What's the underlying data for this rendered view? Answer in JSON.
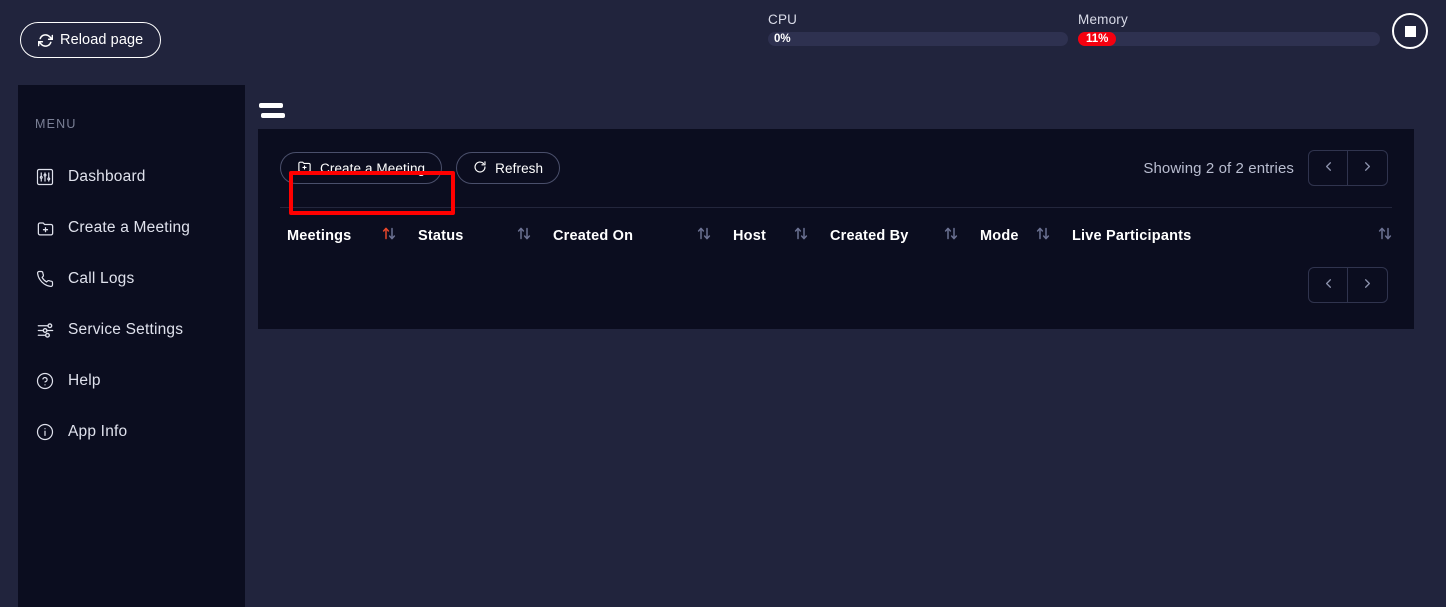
{
  "topbar": {
    "reload_label": "Reload page",
    "reload_icon": "refresh-icon",
    "cpu": {
      "label": "CPU",
      "value": "0%"
    },
    "memory": {
      "label": "Memory",
      "value": "11%"
    },
    "stop_icon": "stop-square-icon",
    "badge_color": "#f5000f"
  },
  "sidebar": {
    "title": "MENU",
    "items": [
      {
        "label": "Dashboard",
        "icon": "dashboard-sliders-icon"
      },
      {
        "label": "Create a Meeting",
        "icon": "folder-plus-icon"
      },
      {
        "label": "Call Logs",
        "icon": "phone-icon"
      },
      {
        "label": "Service Settings",
        "icon": "settings-sliders-icon"
      },
      {
        "label": "Help",
        "icon": "question-circle-icon"
      },
      {
        "label": "App Info",
        "icon": "info-circle-icon"
      }
    ]
  },
  "main": {
    "toggle_icon": "menu-toggle-icon",
    "toolbar": {
      "create_label": "Create a Meeting",
      "create_icon": "folder-plus-icon",
      "refresh_label": "Refresh",
      "refresh_icon": "refresh-circle-icon",
      "entries_text": "Showing 2 of 2 entries",
      "prev_icon": "chevron-left-icon",
      "next_icon": "chevron-right-icon",
      "highlight_color": "#ff0000"
    },
    "table": {
      "columns": [
        {
          "label": "Meetings",
          "sort": "active"
        },
        {
          "label": "Status",
          "sort": "inactive"
        },
        {
          "label": "Created On",
          "sort": "inactive"
        },
        {
          "label": "Host",
          "sort": "inactive"
        },
        {
          "label": "Created By",
          "sort": "inactive"
        },
        {
          "label": "Mode",
          "sort": "inactive"
        },
        {
          "label": "Live Participants",
          "sort": "inactive"
        }
      ],
      "rows": []
    },
    "footer": {
      "prev_icon": "chevron-left-icon",
      "next_icon": "chevron-right-icon"
    }
  }
}
